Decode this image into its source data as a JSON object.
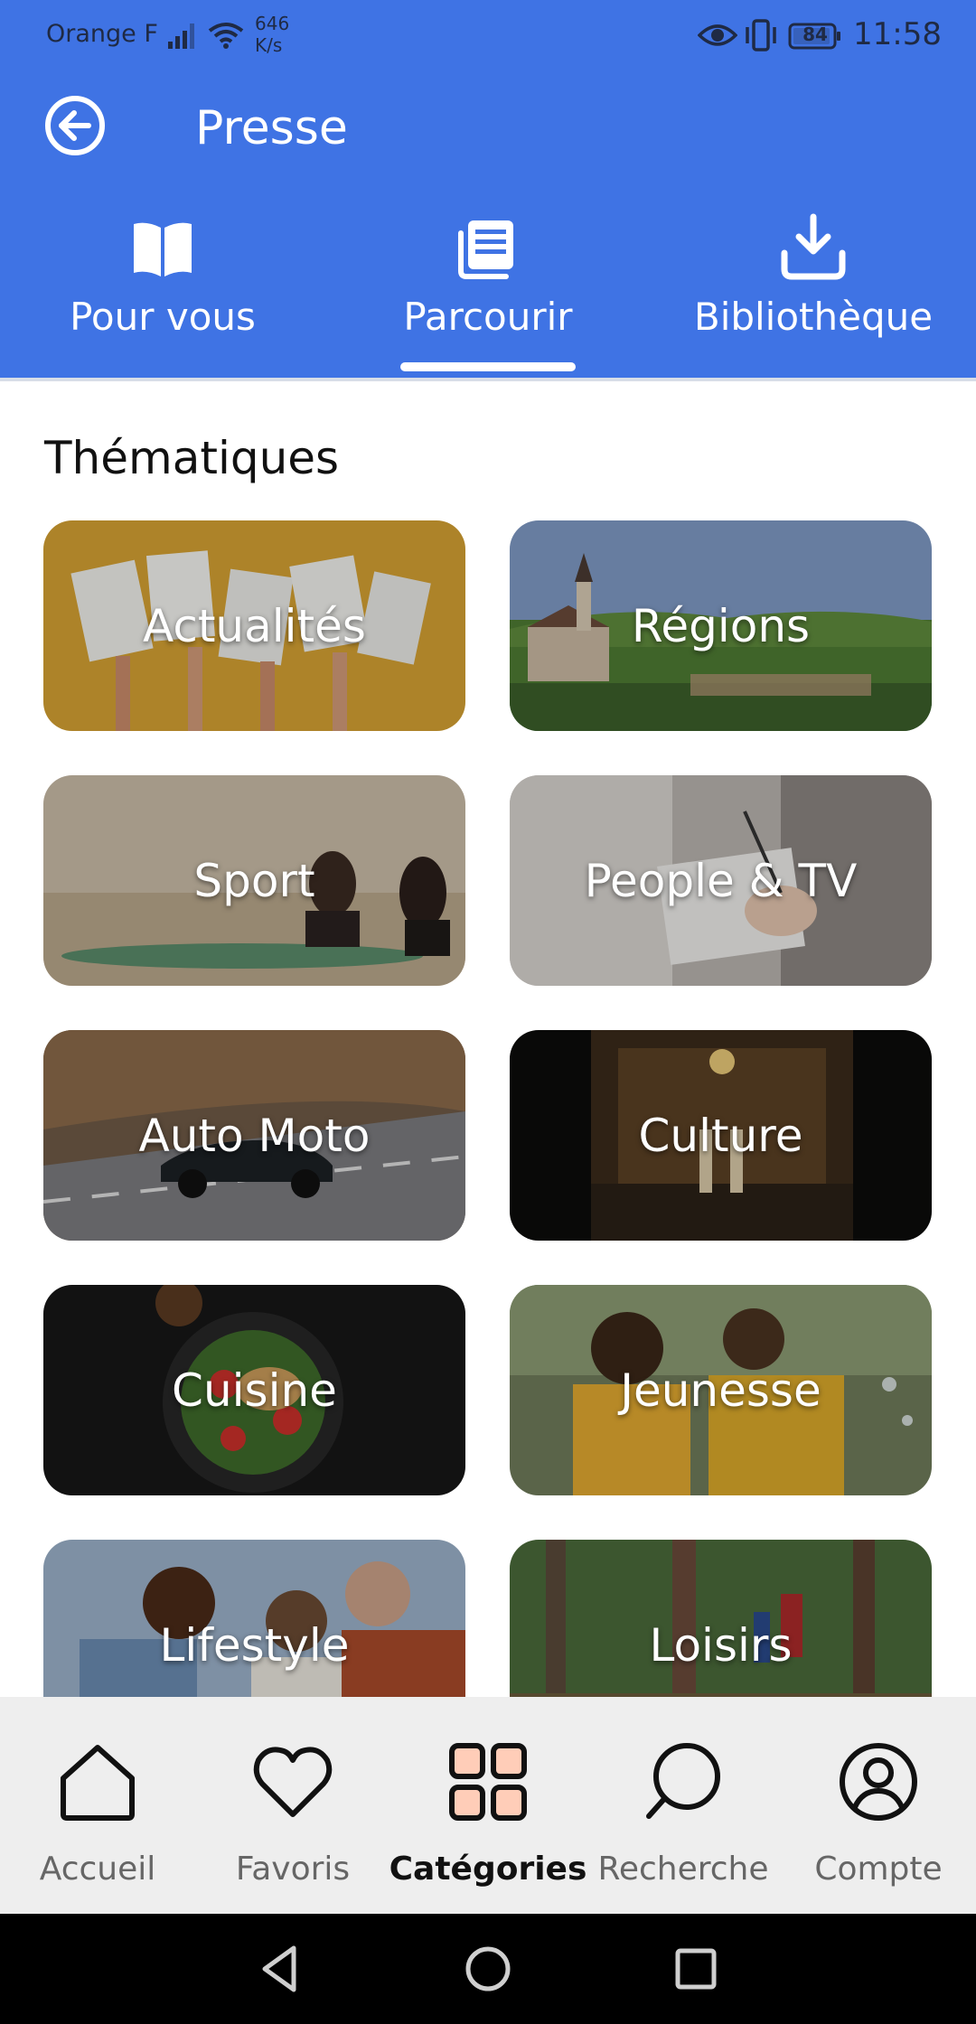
{
  "status_bar": {
    "carrier": "Orange F",
    "speed_value": "646",
    "speed_unit": "K/s",
    "battery": "84",
    "time": "11:58"
  },
  "app_bar": {
    "title": "Presse",
    "back_icon": "back-arrow-icon"
  },
  "tabs": [
    {
      "label": "Pour vous",
      "icon": "open-book-icon",
      "selected": false
    },
    {
      "label": "Parcourir",
      "icon": "newspaper-icon",
      "selected": true
    },
    {
      "label": "Bibliothèque",
      "icon": "download-icon",
      "selected": false
    }
  ],
  "section": {
    "title": "Thématiques"
  },
  "categories": [
    {
      "label": "Actualités"
    },
    {
      "label": "Régions"
    },
    {
      "label": "Sport"
    },
    {
      "label": "People & TV"
    },
    {
      "label": "Auto Moto"
    },
    {
      "label": "Culture"
    },
    {
      "label": "Cuisine"
    },
    {
      "label": "Jeunesse"
    },
    {
      "label": "Lifestyle"
    },
    {
      "label": "Loisirs"
    }
  ],
  "bottom_nav": [
    {
      "label": "Accueil",
      "icon": "home-icon",
      "active": false
    },
    {
      "label": "Favoris",
      "icon": "heart-icon",
      "active": false
    },
    {
      "label": "Catégories",
      "icon": "grid-icon",
      "active": true
    },
    {
      "label": "Recherche",
      "icon": "search-icon",
      "active": false
    },
    {
      "label": "Compte",
      "icon": "account-icon",
      "active": false
    }
  ],
  "colors": {
    "header_blue": "#3f73e4",
    "active_nav_accent": "#ffcdb8",
    "nav_background": "#eeeeee"
  }
}
